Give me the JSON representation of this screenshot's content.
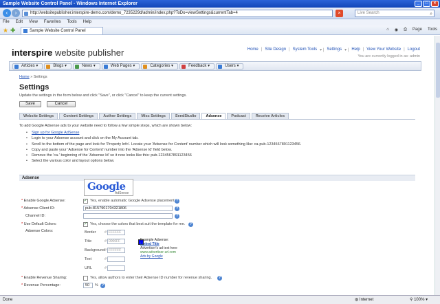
{
  "window": {
    "title": "Sample Website Control Panel - Windows Internet Explorer"
  },
  "browser": {
    "address": "http://websitepublisher.interspire-demo.com/demo_7235229d/admin/index.php?ToDo=viewSettings&currentTab=4",
    "search_placeholder": "Live Search",
    "menu": [
      "File",
      "Edit",
      "View",
      "Favorites",
      "Tools",
      "Help"
    ],
    "tab_title": "Sample Website Control Panel",
    "cmd": [
      "Page",
      "Tools"
    ],
    "status": "Done",
    "zone": "Internet",
    "zoom": "100%"
  },
  "header": {
    "logo_bold": "interspire",
    "logo_rest": "website publisher",
    "links": [
      "Home",
      "Site Design",
      "System Tools",
      "Settings",
      "Help",
      "View Your Website",
      "Logout"
    ],
    "logged_in": "You are currently logged in as: admin"
  },
  "nav": [
    "Articles",
    "Blogs",
    "News",
    "Web Pages",
    "Categories",
    "Feedback",
    "Users"
  ],
  "nav_colors": [
    "#3a7bd5",
    "#e09020",
    "#4a9a4a",
    "#3a7bd5",
    "#e09020",
    "#d04040",
    "#3a7bd5"
  ],
  "breadcrumb": {
    "home": "Home",
    "sep": "»",
    "current": "Settings"
  },
  "page": {
    "title": "Settings",
    "intro": "Update the settings in the form below and click \"Save\", or click \"Cancel\" to keep the current settings.",
    "save": "Save",
    "cancel": "Cancel"
  },
  "tabs": [
    "Website Settings",
    "Content Settings",
    "Author Settings",
    "Misc Settings",
    "SendStudio",
    "Adsense",
    "Podcast",
    "Receive Articles"
  ],
  "adsense": {
    "instructions": "To add Google Adsense ads to your website need to follow a few simple steps, which are shown below:",
    "steps": [
      "Sign up for Google AdSense",
      "Login to your Adsense account and click on the My Account tab.",
      "Scroll to the bottom of the page and look for 'Property Info'. Locate your 'Adsense for Content' number which will look something like: ca-pub-1234567891123456.",
      "Copy and paste your 'Adsense for Content' number into the 'Adsense Id' field below.",
      "Remove the 'ca-' beginning of the 'Adsense Id' so it now looks like this: pub-1234567891123456",
      "Select the various color and layout options below."
    ],
    "section": "Adsense",
    "google_word": "Google",
    "google_sub": "AdSense",
    "enable_label": "Enable Google Adsense:",
    "enable_text": "Yes, enable automatic Google Adsense placement",
    "client_label": "Adsense Client ID:",
    "client_value": "pub-8157901704321806",
    "channel_label": "Channel ID:",
    "channel_value": "",
    "default_colors_label": "Use Default Colors:",
    "default_colors_text": "Yes, choose the colors that best suit the template for me.",
    "colors_label": "Adsense Colors:",
    "color_rows": [
      {
        "label": "Border",
        "value": "FFFFFF"
      },
      {
        "label": "Title",
        "value": "0000FF"
      },
      {
        "label": "Background",
        "value": "FFFFFF"
      },
      {
        "label": "Text",
        "value": ""
      },
      {
        "label": "URL",
        "value": ""
      }
    ],
    "example_head": "Example Adsense:",
    "example_link": "Linked Title",
    "example_text": "Advertiser's ad text here",
    "example_url": "www.advertiser-url.com",
    "example_ads": "Ads by Google",
    "revshare_label": "Enable Revenue Sharing:",
    "revshare_text": "Yes, allow authors to enter their Adsense ID number for revenue sharing.",
    "revpct_label": "Revenue Percentage:",
    "revpct_value": "50",
    "revpct_unit": "%"
  }
}
